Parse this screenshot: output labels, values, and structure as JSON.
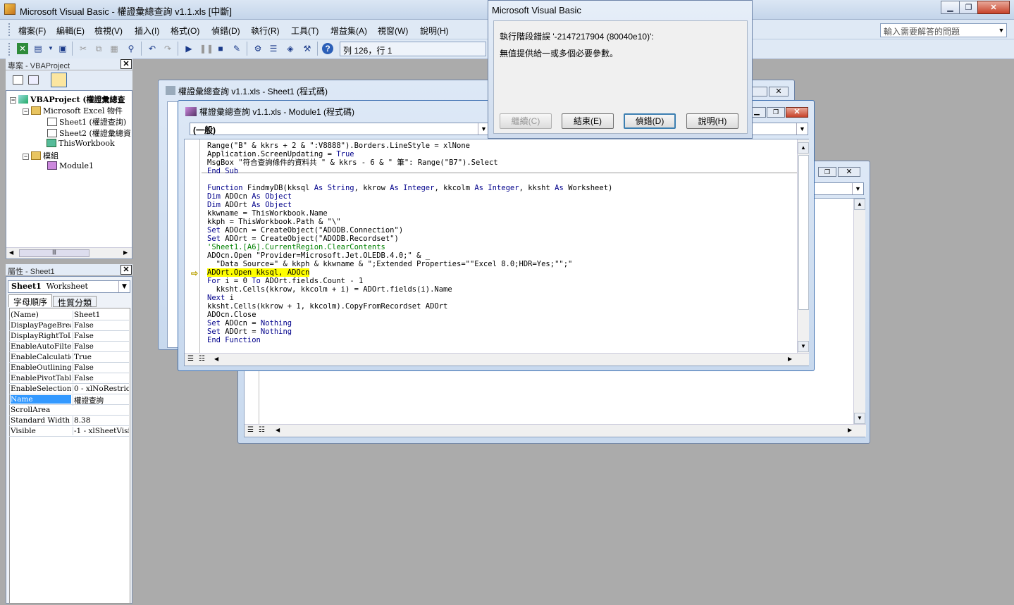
{
  "app": {
    "title": "Microsoft Visual Basic - 權證彙總查詢 v1.1.xls [中斷]"
  },
  "menu": {
    "items": [
      "檔案(F)",
      "編輯(E)",
      "檢視(V)",
      "插入(I)",
      "格式(O)",
      "偵錯(D)",
      "執行(R)",
      "工具(T)",
      "增益集(A)",
      "視窗(W)",
      "說明(H)"
    ]
  },
  "help": {
    "placeholder": "輸入需要解答的問題"
  },
  "toolbar": {
    "position": "列 126，行 1"
  },
  "project": {
    "header": "專案 - VBAProject",
    "root": "VBAProject (權證彙總查",
    "excel_objects": "Microsoft Excel 物件",
    "sheet1": "Sheet1 (權證查詢)",
    "sheet2": "Sheet2 (權證彙總資",
    "thisworkbook": "ThisWorkbook",
    "modules": "模組",
    "module1": "Module1"
  },
  "properties": {
    "header": "屬性 - Sheet1",
    "object_name": "Sheet1",
    "object_type": "Worksheet",
    "tab_alpha": "字母順序",
    "tab_cat": "性質分類",
    "rows": [
      {
        "k": "(Name)",
        "v": "Sheet1"
      },
      {
        "k": "DisplayPageBreak",
        "v": "False"
      },
      {
        "k": "DisplayRightToLe",
        "v": "False"
      },
      {
        "k": "EnableAutoFilter",
        "v": "False"
      },
      {
        "k": "EnableCalculation",
        "v": "True"
      },
      {
        "k": "EnableOutlining",
        "v": "False"
      },
      {
        "k": "EnablePivotTable",
        "v": "False"
      },
      {
        "k": "EnableSelection",
        "v": "0 - xlNoRestricti"
      },
      {
        "k": "Name",
        "v": "權證查詢"
      },
      {
        "k": "ScrollArea",
        "v": ""
      },
      {
        "k": "Standard Width",
        "v": "8.38"
      },
      {
        "k": "Visible",
        "v": "-1 - xlSheetVisib"
      }
    ]
  },
  "windows": {
    "sheet1": {
      "title": "權證彙總查詢 v1.1.xls - Sheet1 (程式碼)"
    },
    "module1": {
      "title": "權證彙總查詢 v1.1.xls - Module1 (程式碼)",
      "object_combo": "(一般)"
    }
  },
  "code": {
    "lines": [
      [
        [
          "t",
          "Range(\"B\" & kkrs + 2 & \":V8888\").Borders.LineStyle = xlNone"
        ]
      ],
      [
        [
          "t",
          "Application.ScreenUpdating = "
        ],
        [
          "k",
          "True"
        ]
      ],
      [
        [
          "t",
          "MsgBox \"符合查詢條件的資料共 \" & kkrs - 6 & \" 筆\": Range(\"B7\").Select"
        ]
      ],
      [
        [
          "k",
          "End Sub"
        ]
      ],
      [
        [
          "t",
          ""
        ]
      ],
      [
        [
          "k",
          "Function"
        ],
        [
          "t",
          " FindmyDB(kksql "
        ],
        [
          "k",
          "As String"
        ],
        [
          "t",
          ", kkrow "
        ],
        [
          "k",
          "As Integer"
        ],
        [
          "t",
          ", kkcolm "
        ],
        [
          "k",
          "As Integer"
        ],
        [
          "t",
          ", kksht "
        ],
        [
          "k",
          "As"
        ],
        [
          "t",
          " Worksheet)"
        ]
      ],
      [
        [
          "k",
          "Dim"
        ],
        [
          "t",
          " ADOcn "
        ],
        [
          "k",
          "As Object"
        ]
      ],
      [
        [
          "k",
          "Dim"
        ],
        [
          "t",
          " ADOrt "
        ],
        [
          "k",
          "As Object"
        ]
      ],
      [
        [
          "t",
          "kkwname = ThisWorkbook.Name"
        ]
      ],
      [
        [
          "t",
          "kkph = ThisWorkbook.Path & \"\\\""
        ]
      ],
      [
        [
          "k",
          "Set"
        ],
        [
          "t",
          " ADOcn = CreateObject(\"ADODB.Connection\")"
        ]
      ],
      [
        [
          "k",
          "Set"
        ],
        [
          "t",
          " ADOrt = CreateObject(\"ADODB.Recordset\")"
        ]
      ],
      [
        [
          "c",
          "'Sheet1.[A6].CurrentRegion.ClearContents"
        ]
      ],
      [
        [
          "t",
          "ADOcn.Open \"Provider=Microsoft.Jet.OLEDB.4.0;\" & _"
        ]
      ],
      [
        [
          "t",
          "  \"Data Source=\" & kkph & kkwname & \";Extended Properties=\"\"Excel 8.0;HDR=Yes;\"\";\""
        ]
      ],
      [
        [
          "h",
          "ADOrt.Open kksql, ADOcn"
        ]
      ],
      [
        [
          "k",
          "For"
        ],
        [
          "t",
          " i = 0 "
        ],
        [
          "k",
          "To"
        ],
        [
          "t",
          " ADOrt.fields.Count - 1"
        ]
      ],
      [
        [
          "t",
          "  kksht.Cells(kkrow, kkcolm + i) = ADOrt.fields(i).Name"
        ]
      ],
      [
        [
          "k",
          "Next"
        ],
        [
          "t",
          " i"
        ]
      ],
      [
        [
          "t",
          "kksht.Cells(kkrow + 1, kkcolm).CopyFromRecordset ADOrt"
        ]
      ],
      [
        [
          "t",
          "ADOcn.Close"
        ]
      ],
      [
        [
          "k",
          "Set"
        ],
        [
          "t",
          " ADOcn = "
        ],
        [
          "k",
          "Nothing"
        ]
      ],
      [
        [
          "k",
          "Set"
        ],
        [
          "t",
          " ADOrt = "
        ],
        [
          "k",
          "Nothing"
        ]
      ],
      [
        [
          "k",
          "End Function"
        ]
      ]
    ]
  },
  "dialog": {
    "title": "Microsoft Visual Basic",
    "error": "執行階段錯誤 '-2147217904 (80040e10)':",
    "message": "無值提供給一或多個必要參數。",
    "btn_continue": "繼續(C)",
    "btn_end": "結束(E)",
    "btn_debug": "偵錯(D)",
    "btn_help": "說明(H)"
  }
}
